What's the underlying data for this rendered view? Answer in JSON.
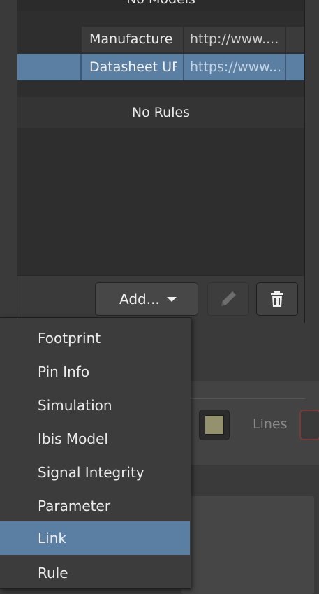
{
  "models_table": {
    "empty_text": "No Models"
  },
  "parameters_table": {
    "rows": [
      {
        "name": "Manufacture",
        "value": "http://www....",
        "selected": false
      },
      {
        "name": "Datasheet UF",
        "value": "https://www...",
        "selected": true
      }
    ]
  },
  "rules_table": {
    "empty_text": "No Rules"
  },
  "footer": {
    "add_label": "Add...",
    "edit_icon": "pencil-icon",
    "delete_icon": "trash-icon"
  },
  "background_controls": {
    "lines_label": "Lines",
    "swatch_color": "#94916e"
  },
  "add_menu": {
    "items": [
      "Footprint",
      "Pin Info",
      "Simulation",
      "Ibis Model",
      "Signal Integrity",
      "Parameter",
      "Link",
      "Rule"
    ],
    "highlighted": "Link"
  },
  "colors": {
    "selection": "#5b7fa3",
    "panel_bg": "#2e2e2e",
    "page_bg": "#3a3a3a"
  }
}
